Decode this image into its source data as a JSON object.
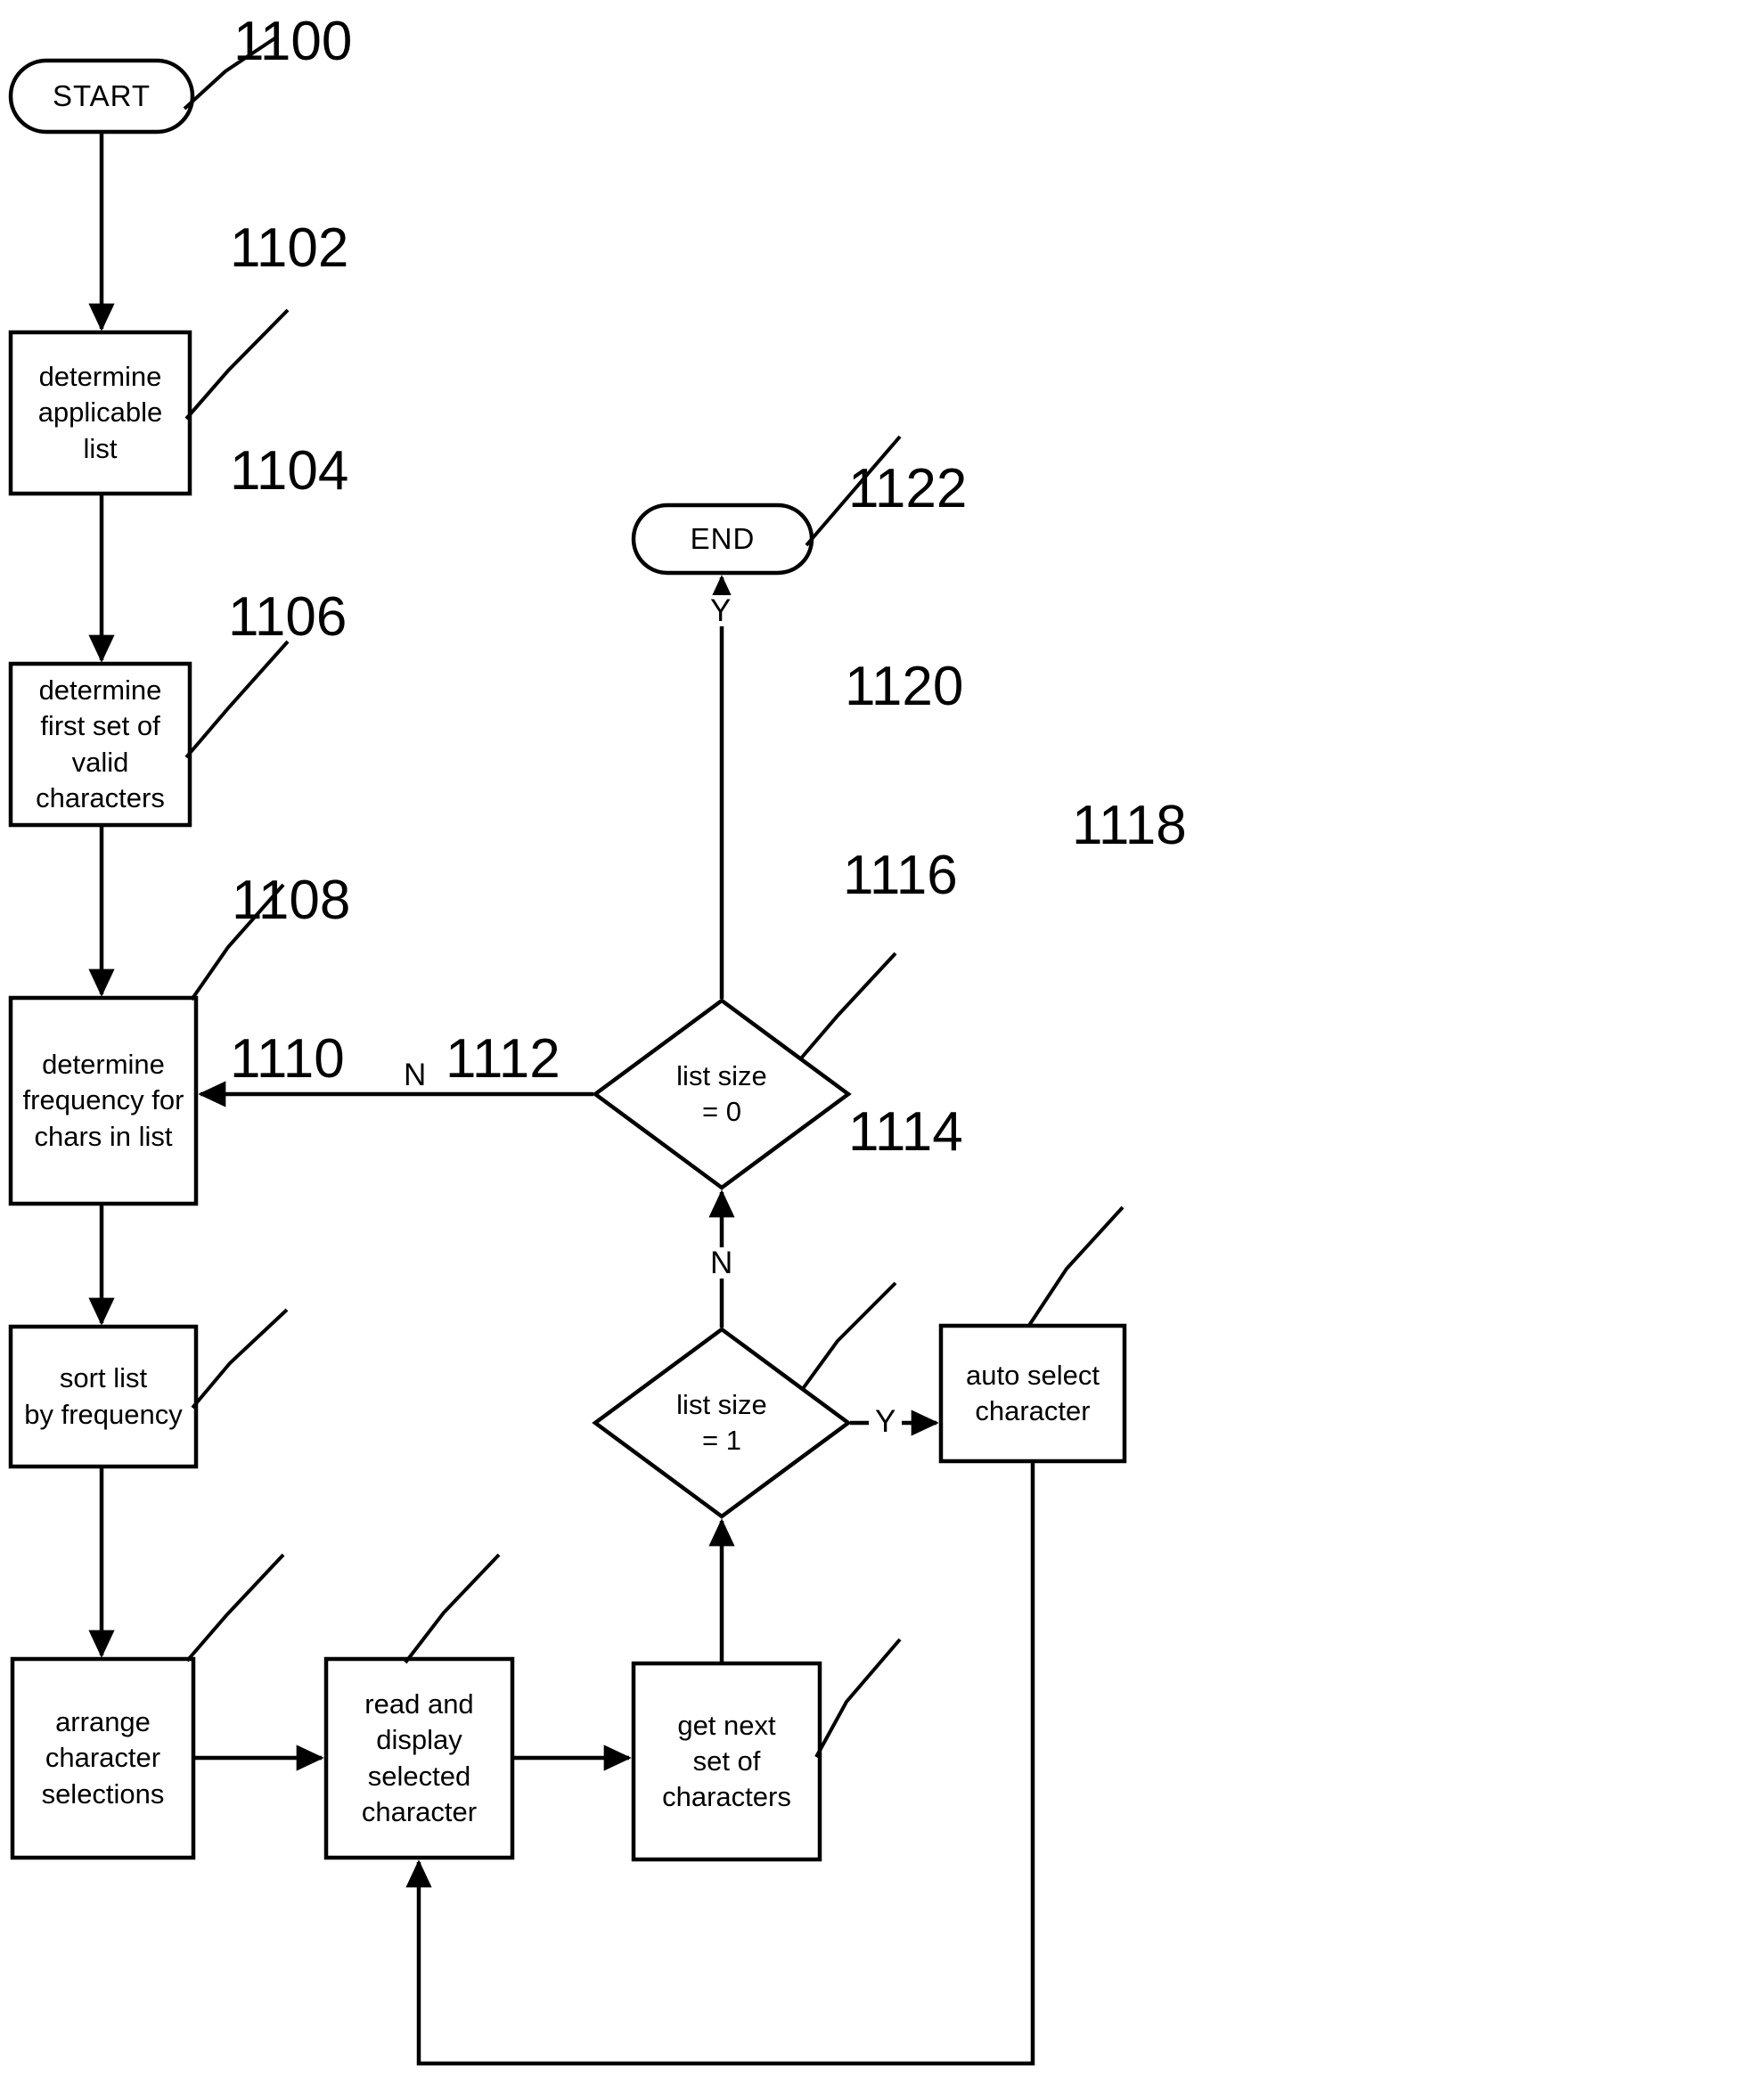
{
  "figure": {
    "type": "flowchart",
    "background_color": "#ffffff",
    "line_color": "#000000"
  },
  "nodes": {
    "start": {
      "ref": "1100",
      "label": "START",
      "shape": "terminal"
    },
    "determine_applicable_list": {
      "ref": "1102",
      "label": "determine\napplicable\nlist",
      "shape": "process"
    },
    "determine_first_set": {
      "ref": "1104",
      "label": "determine\nfirst set of valid\ncharacters",
      "shape": "process"
    },
    "determine_frequency": {
      "ref": "1106",
      "label": "determine\nfrequency for\nchars in list",
      "shape": "process"
    },
    "sort_list": {
      "ref": "1108",
      "label": "sort list\nby frequency",
      "shape": "process"
    },
    "arrange_selections": {
      "ref": "1110",
      "label": "arrange\ncharacter\nselections",
      "shape": "process"
    },
    "read_display": {
      "ref": "1112",
      "label": "read and\ndisplay selected\ncharacter",
      "shape": "process"
    },
    "get_next_set": {
      "ref": "1114",
      "label": "get next\nset of\ncharacters",
      "shape": "process"
    },
    "list_size_1": {
      "ref": "1116",
      "label": "list size\n= 1",
      "shape": "decision"
    },
    "auto_select": {
      "ref": "1118",
      "label": "auto select\ncharacter",
      "shape": "process"
    },
    "list_size_0": {
      "ref": "1120",
      "label": "list size\n= 0",
      "shape": "decision"
    },
    "end": {
      "ref": "1122",
      "label": "END",
      "shape": "terminal"
    }
  },
  "edge_labels": {
    "list_size_0_yes": "Y",
    "list_size_0_no": "N",
    "list_size_1_yes": "Y",
    "list_size_1_no": "N"
  }
}
